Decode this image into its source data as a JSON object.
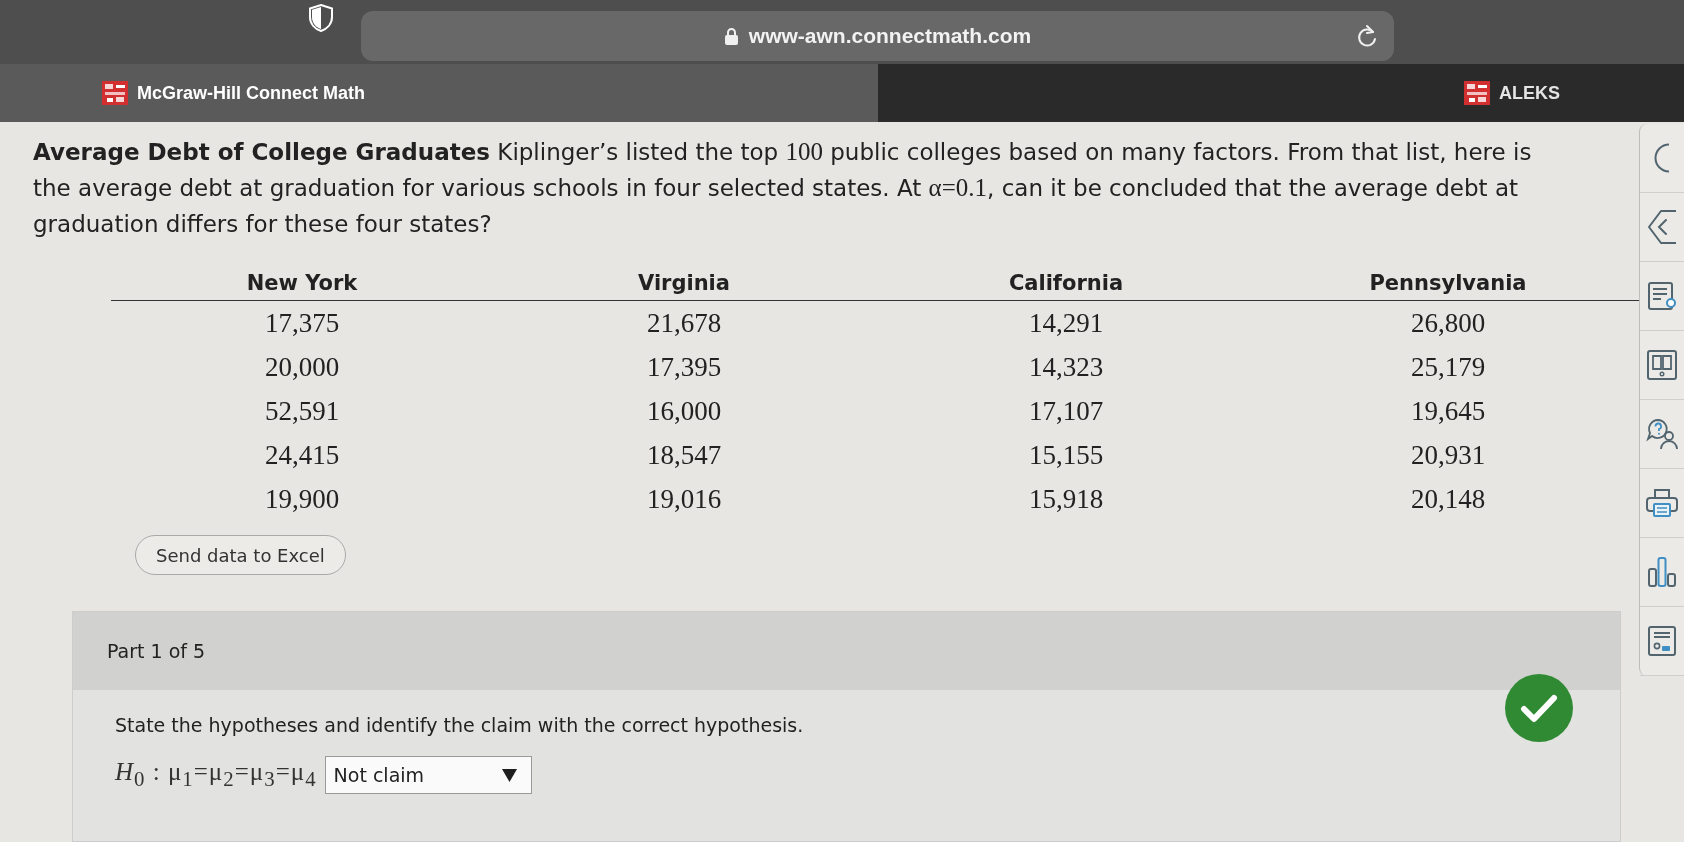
{
  "browser": {
    "url": "www-awn.connectmath.com"
  },
  "tabs": [
    {
      "label": "McGraw-Hill Connect Math",
      "selected": true
    },
    {
      "label": "ALEKS",
      "selected": false
    }
  ],
  "problem": {
    "segments": [
      {
        "kind": "title",
        "text": "Average Debt of College Graduates"
      },
      {
        "kind": "text",
        "text": " Kiplinger’s listed the top "
      },
      {
        "kind": "math",
        "text": "100"
      },
      {
        "kind": "text",
        "text": " public colleges based on many factors. From that list, here is the average debt at graduation for various schools in four selected states. At "
      },
      {
        "kind": "math",
        "text": "α=0.1"
      },
      {
        "kind": "text",
        "text": ", can it be concluded that the average debt at graduation differs for these four states?"
      }
    ]
  },
  "table": {
    "columns": [
      "New York",
      "Virginia",
      "California",
      "Pennsylvania"
    ],
    "rows": [
      [
        "17,375",
        "21,678",
        "14,291",
        "26,800"
      ],
      [
        "20,000",
        "17,395",
        "14,323",
        "25,179"
      ],
      [
        "52,591",
        "16,000",
        "17,107",
        "19,645"
      ],
      [
        "24,415",
        "18,547",
        "15,155",
        "20,931"
      ],
      [
        "19,900",
        "19,016",
        "15,918",
        "20,148"
      ]
    ]
  },
  "excel_button": "Send data to Excel",
  "part": {
    "label": "Part 1 of 5",
    "correct": true,
    "instruction": "State the hypotheses and identify the claim with the correct hypothesis.",
    "hypothesis": "*H*$_{0}$ : μ$_{1}$=μ$_{2}$=μ$_{3}$=μ$_{4}$",
    "claim_select": {
      "value": "Not claim"
    }
  }
}
